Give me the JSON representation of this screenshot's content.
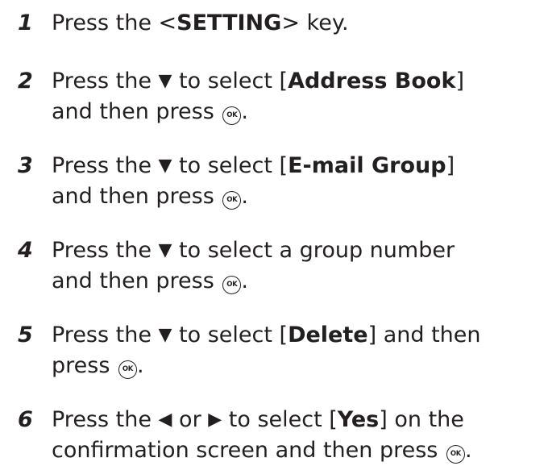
{
  "icons": {
    "down": "▼",
    "left": "◀",
    "right": "▶",
    "ok": "OK"
  },
  "steps": [
    {
      "number": "1",
      "lines": [
        [
          "Press the <",
          "SETTING",
          "> key."
        ]
      ]
    },
    {
      "number": "2",
      "lines": [
        [
          "Press the ",
          " to select [",
          "Address Book",
          "]"
        ],
        [
          "and then press ",
          "."
        ]
      ]
    },
    {
      "number": "3",
      "lines": [
        [
          "Press the ",
          " to select [",
          "E-mail Group",
          "]"
        ],
        [
          "and then press ",
          "."
        ]
      ]
    },
    {
      "number": "4",
      "lines": [
        [
          "Press the ",
          " to select a group number"
        ],
        [
          "and then press ",
          "."
        ]
      ]
    },
    {
      "number": "5",
      "lines": [
        [
          "Press the ",
          " to select [",
          "Delete",
          "] and then"
        ],
        [
          "press ",
          "."
        ]
      ]
    },
    {
      "number": "6",
      "lines": [
        [
          "Press the ",
          " or ",
          " to select [",
          "Yes",
          "] on the"
        ],
        [
          "confirmation screen and then press ",
          "."
        ]
      ]
    }
  ]
}
